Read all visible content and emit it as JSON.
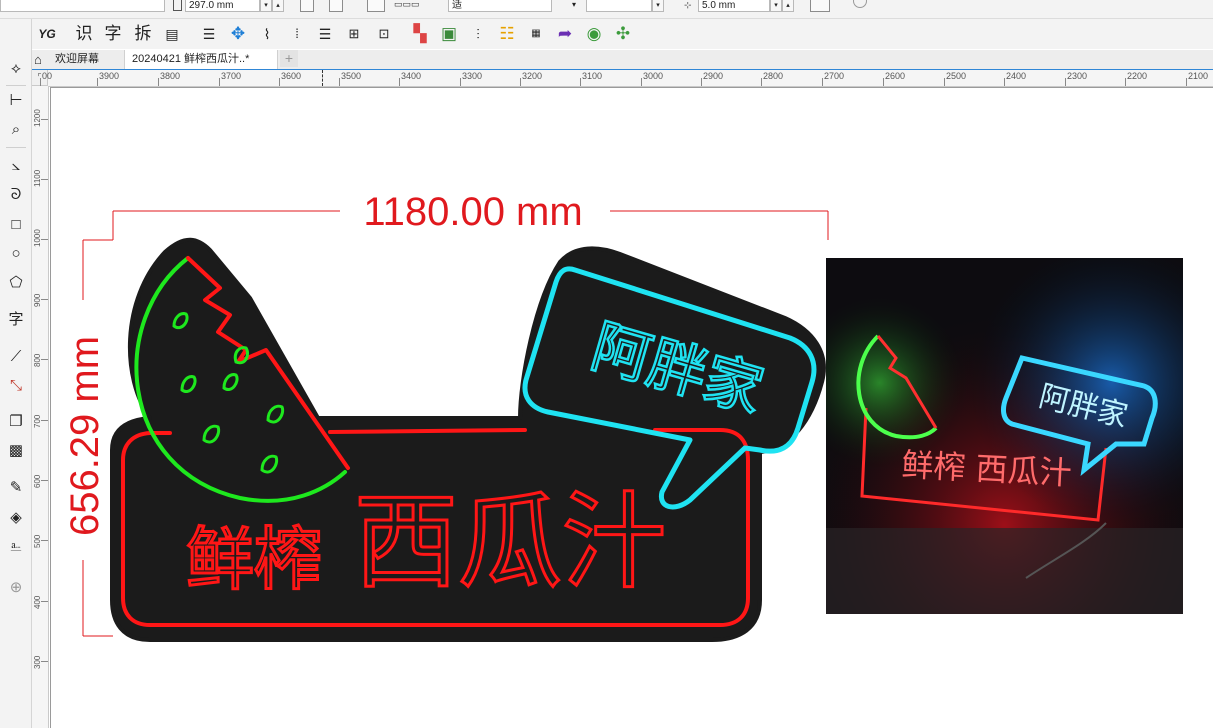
{
  "property_bar": {
    "height_value": "297.0 mm",
    "unknown_field": "适",
    "offset_value": "5.0 mm"
  },
  "toolbar": {
    "text_tools": [
      "YG",
      "识",
      "字",
      "拆"
    ]
  },
  "tabs": [
    {
      "label": "欢迎屏幕",
      "active": false
    },
    {
      "label": "20240421 鲜榨西瓜汁..*",
      "active": true
    }
  ],
  "ruler": {
    "horizontal_ticks": [
      "00",
      "3900",
      "3800",
      "3700",
      "3600",
      "3500",
      "3400",
      "3300",
      "3200",
      "3100",
      "3000",
      "2900",
      "2800",
      "2700",
      "2600",
      "2500",
      "2400",
      "2300",
      "2200",
      "2100"
    ],
    "vertical_ticks": [
      "1200",
      "1100",
      "1000",
      "900",
      "800",
      "700",
      "600",
      "500",
      "400",
      "300"
    ]
  },
  "design": {
    "width_dimension": "1180.00 mm",
    "height_dimension": "656.29 mm",
    "bubble_text": "阿胖家",
    "small_text": "鲜榨",
    "big_text": "西瓜汁",
    "colors": {
      "dimension_red": "#e0191e",
      "panel_fill": "#1b1b1b",
      "neon_red": "#ff1616",
      "neon_green": "#1ee81e",
      "neon_cyan": "#1fe3f2"
    }
  },
  "photo": {
    "bubble_text": "阿胖家",
    "sign_text": "鲜榨 西瓜汁"
  }
}
